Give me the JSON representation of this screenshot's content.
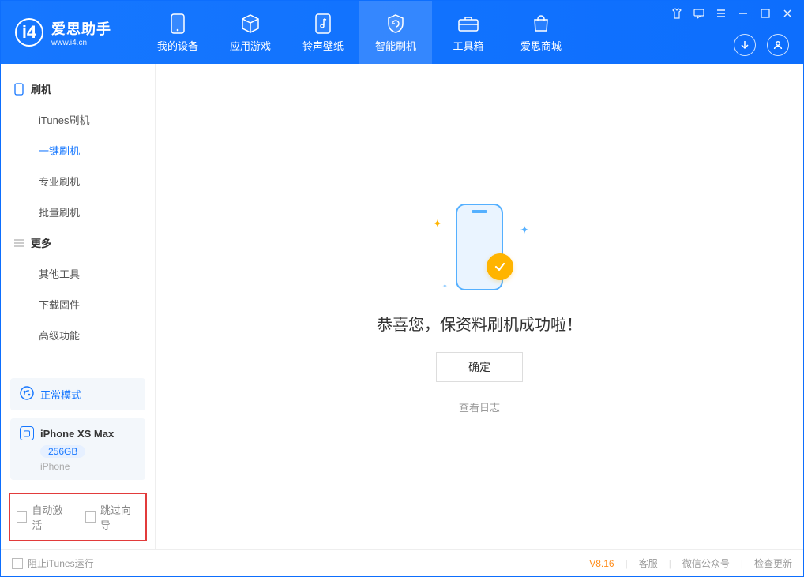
{
  "header": {
    "logo_title": "爱思助手",
    "logo_sub": "www.i4.cn",
    "tabs": [
      {
        "label": "我的设备"
      },
      {
        "label": "应用游戏"
      },
      {
        "label": "铃声壁纸"
      },
      {
        "label": "智能刷机"
      },
      {
        "label": "工具箱"
      },
      {
        "label": "爱思商城"
      }
    ]
  },
  "sidebar": {
    "section1": {
      "title": "刷机",
      "items": [
        "iTunes刷机",
        "一键刷机",
        "专业刷机",
        "批量刷机"
      ]
    },
    "section2": {
      "title": "更多",
      "items": [
        "其他工具",
        "下载固件",
        "高级功能"
      ]
    },
    "mode_label": "正常模式",
    "device_name": "iPhone XS Max",
    "device_capacity": "256GB",
    "device_type": "iPhone",
    "opt_auto_activate": "自动激活",
    "opt_skip_guide": "跳过向导"
  },
  "main": {
    "success_text": "恭喜您，保资料刷机成功啦！",
    "ok_button": "确定",
    "view_log": "查看日志"
  },
  "footer": {
    "block_itunes": "阻止iTunes运行",
    "version": "V8.16",
    "link_cs": "客服",
    "link_wechat": "微信公众号",
    "link_update": "检查更新"
  }
}
